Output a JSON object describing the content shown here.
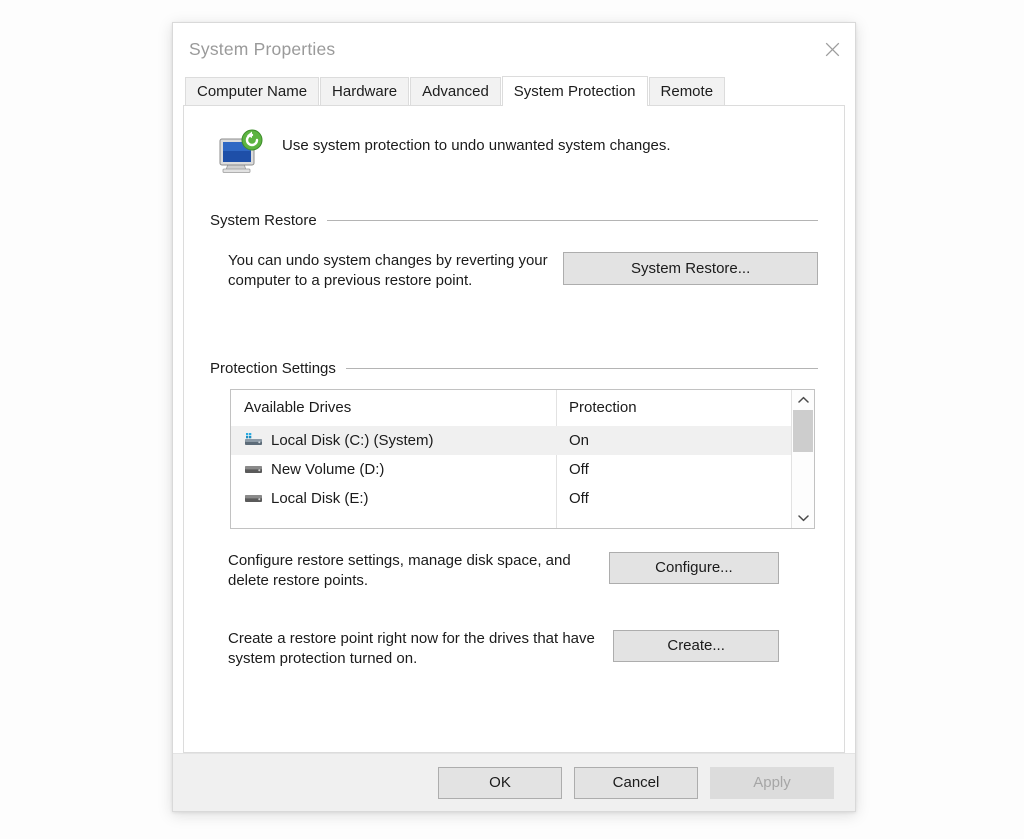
{
  "window": {
    "title": "System Properties",
    "close_icon": "close-icon"
  },
  "tabs": [
    {
      "label": "Computer Name",
      "active": false
    },
    {
      "label": "Hardware",
      "active": false
    },
    {
      "label": "Advanced",
      "active": false
    },
    {
      "label": "System Protection",
      "active": true
    },
    {
      "label": "Remote",
      "active": false
    }
  ],
  "intro": {
    "icon": "system-protection-computer-icon",
    "text": "Use system protection to undo unwanted system changes."
  },
  "system_restore": {
    "group_label": "System Restore",
    "description": "You can undo system changes by reverting your computer to a previous restore point.",
    "button_label": "System Restore..."
  },
  "protection_settings": {
    "group_label": "Protection Settings",
    "columns": [
      "Available Drives",
      "Protection"
    ],
    "drives": [
      {
        "name": "Local Disk (C:) (System)",
        "protection": "On",
        "icon": "system-drive-icon",
        "selected": true
      },
      {
        "name": "New Volume (D:)",
        "protection": "Off",
        "icon": "drive-icon",
        "selected": false
      },
      {
        "name": "Local Disk (E:)",
        "protection": "Off",
        "icon": "drive-icon",
        "selected": false
      }
    ],
    "scroll_up_icon": "chevron-up-icon",
    "scroll_down_icon": "chevron-down-icon"
  },
  "configure": {
    "description": "Configure restore settings, manage disk space, and delete restore points.",
    "button_label": "Configure..."
  },
  "create": {
    "description": "Create a restore point right now for the drives that have system protection turned on.",
    "button_label": "Create..."
  },
  "footer": {
    "ok_label": "OK",
    "cancel_label": "Cancel",
    "apply_label": "Apply",
    "apply_disabled": true
  },
  "colors": {
    "dialog_bg": "#ffffff",
    "footer_bg": "#f0f0f0",
    "button_face": "#e3e3e3",
    "button_border": "#adadad",
    "selected_row": "#f0f0f0",
    "title_text": "#9a9a9a",
    "body_text": "#1b1b1b"
  }
}
